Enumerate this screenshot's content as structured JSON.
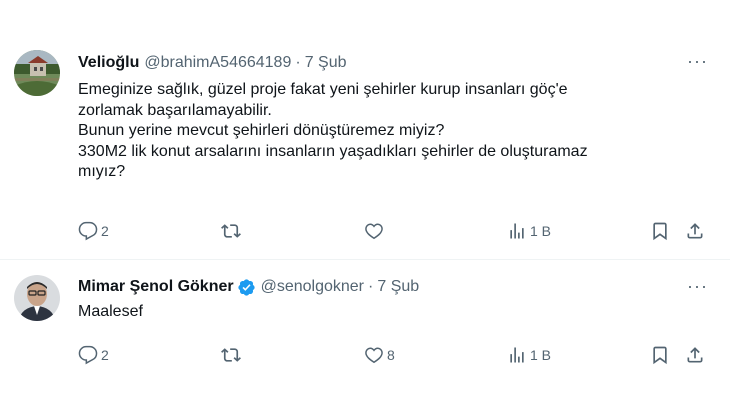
{
  "tweets": [
    {
      "author_name": "Velioğlu",
      "handle": "@brahimA54664189",
      "date": "7 Şub",
      "more_icon": "more-horizontal-icon",
      "lines": [
        "Emeginize sağlık, güzel proje fakat yeni şehirler kurup insanları göç'e",
        "zorlamak başarılamayabilir.",
        "Bunun yerine mevcut şehirleri dönüştüremez miyiz?",
        "330M2 lik konut arsalarını insanların yaşadıkları şehirler de oluşturamaz",
        "mıyız?"
      ],
      "actions": {
        "replies": "2",
        "reposts": "",
        "likes": "",
        "views": "1 B"
      }
    },
    {
      "author_name": "Mimar Şenol Gökner",
      "verified": true,
      "handle": "@senolgokner",
      "date": "7 Şub",
      "more_icon": "more-horizontal-icon",
      "lines": [
        "Maalesef"
      ],
      "actions": {
        "replies": "2",
        "reposts": "",
        "likes": "8",
        "views": "1 B"
      }
    }
  ],
  "colors": {
    "text_primary": "#0f1419",
    "text_secondary": "#536471",
    "verified_blue": "#1d9bf0"
  }
}
